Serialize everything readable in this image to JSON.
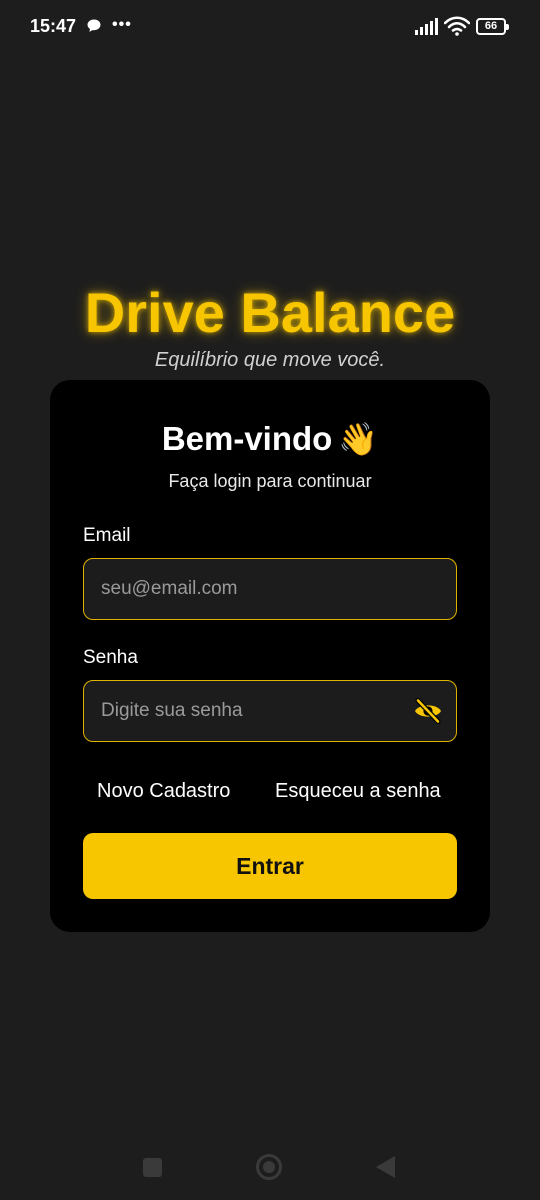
{
  "status_bar": {
    "time": "15:47",
    "more_indicator": "•••",
    "battery_level": "66",
    "icons": [
      "chat-bubble-icon",
      "signal-icon",
      "wifi-icon",
      "battery-icon"
    ]
  },
  "brand": {
    "title": "Drive Balance",
    "subtitle": "Equilíbrio que move você."
  },
  "login_card": {
    "title": "Bem-vindo",
    "title_emoji": "👋",
    "subtitle": "Faça login para continuar",
    "email": {
      "label": "Email",
      "placeholder": "seu@email.com",
      "value": ""
    },
    "password": {
      "label": "Senha",
      "placeholder": "Digite sua senha",
      "value": "",
      "visibility_icon": "eye-off-icon"
    },
    "register_link": "Novo Cadastro",
    "forgot_password_link": "Esqueceu a senha",
    "submit_label": "Entrar"
  },
  "navigation_bar": {
    "buttons": [
      "recent-apps",
      "home",
      "back"
    ]
  },
  "colors": {
    "accent": "#f7c600",
    "background": "#1d1d1d",
    "card": "#000000",
    "input_background": "#1c1c1c"
  }
}
